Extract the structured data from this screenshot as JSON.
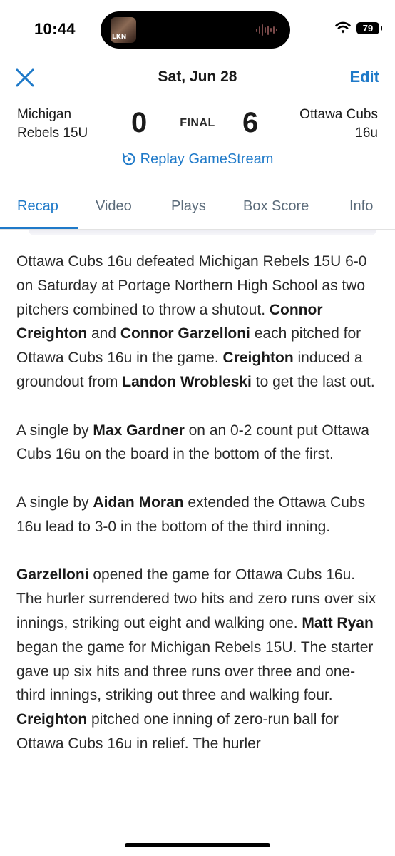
{
  "status_bar": {
    "time": "10:44",
    "battery": "79",
    "now_playing_art_text": "LKN"
  },
  "header": {
    "title": "Sat, Jun 28",
    "edit_label": "Edit"
  },
  "score": {
    "away_team_line1": "Michigan",
    "away_team_line2": "Rebels 15U",
    "away_score": "0",
    "status": "FINAL",
    "home_score": "6",
    "home_team_line1": "Ottawa Cubs",
    "home_team_line2": "16u"
  },
  "replay_label": "Replay GameStream",
  "tabs": [
    {
      "label": "Recap",
      "active": true
    },
    {
      "label": "Video",
      "active": false
    },
    {
      "label": "Plays",
      "active": false
    },
    {
      "label": "Box Score",
      "active": false
    },
    {
      "label": "Info",
      "active": false
    }
  ],
  "recap": {
    "p1": {
      "t1": "Ottawa Cubs 16u defeated Michigan Rebels 15U 6-0 on Saturday at Portage Northern High School as two pitchers combined to throw a shutout. ",
      "b1": "Connor Creighton",
      "t2": " and ",
      "b2": "Connor Garzelloni",
      "t3": " each pitched for Ottawa Cubs 16u in the game. ",
      "b3": "Creighton",
      "t4": " induced a groundout from ",
      "b4": "Landon Wrobleski",
      "t5": " to get the last out."
    },
    "p2": {
      "t1": "A single by ",
      "b1": "Max Gardner",
      "t2": " on an 0-2 count put Ottawa Cubs 16u on the board in the bottom of the first."
    },
    "p3": {
      "t1": "A single by ",
      "b1": "Aidan Moran",
      "t2": " extended the Ottawa Cubs 16u lead to 3-0 in the bottom of the third inning."
    },
    "p4": {
      "b1": "Garzelloni",
      "t1": " opened the game for Ottawa Cubs 16u. The hurler surrendered two hits and zero runs over six innings, striking out eight and walking one. ",
      "b2": "Matt Ryan",
      "t2": " began the game for Michigan Rebels 15U. The starter gave up six hits and three runs over three and one-third innings, striking out three and walking four. ",
      "b3": "Creighton",
      "t3": " pitched one inning of zero-run ball for Ottawa Cubs 16u in relief. The hurler"
    }
  },
  "colors": {
    "accent": "#1f7ac9",
    "tab_inactive": "#5b6b7a",
    "text": "#2a2a2a"
  },
  "icons": [
    "close-icon",
    "replay-icon",
    "wifi-icon",
    "battery-icon",
    "audio-wave-icon"
  ]
}
